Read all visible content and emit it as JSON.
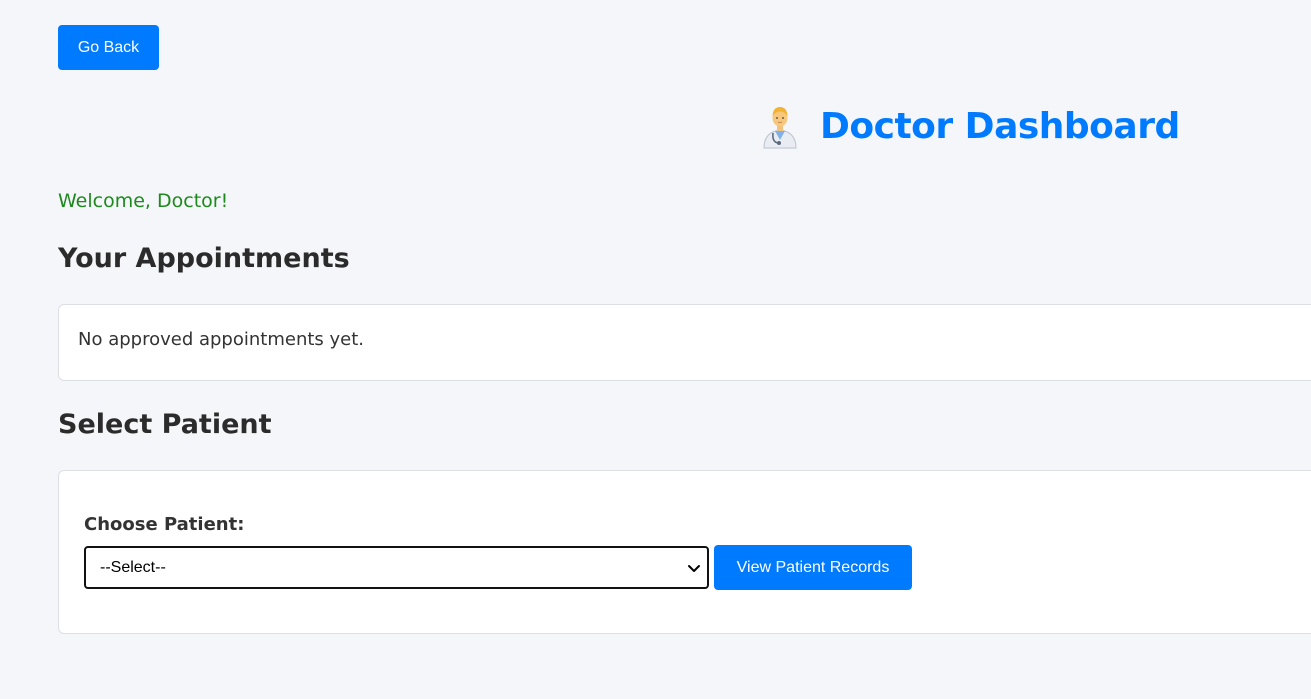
{
  "nav": {
    "back_label": "Go Back"
  },
  "header": {
    "icon": "doctor-icon",
    "title": "Doctor Dashboard"
  },
  "welcome": "Welcome, Doctor!",
  "appointments": {
    "heading": "Your Appointments",
    "empty_message": "No approved appointments yet."
  },
  "patient": {
    "heading": "Select Patient",
    "label": "Choose Patient:",
    "select_value": "--Select--",
    "view_button_label": "View Patient Records"
  },
  "colors": {
    "accent": "#007bff",
    "welcome": "#1e8a1e",
    "background": "#f4f6f9"
  }
}
